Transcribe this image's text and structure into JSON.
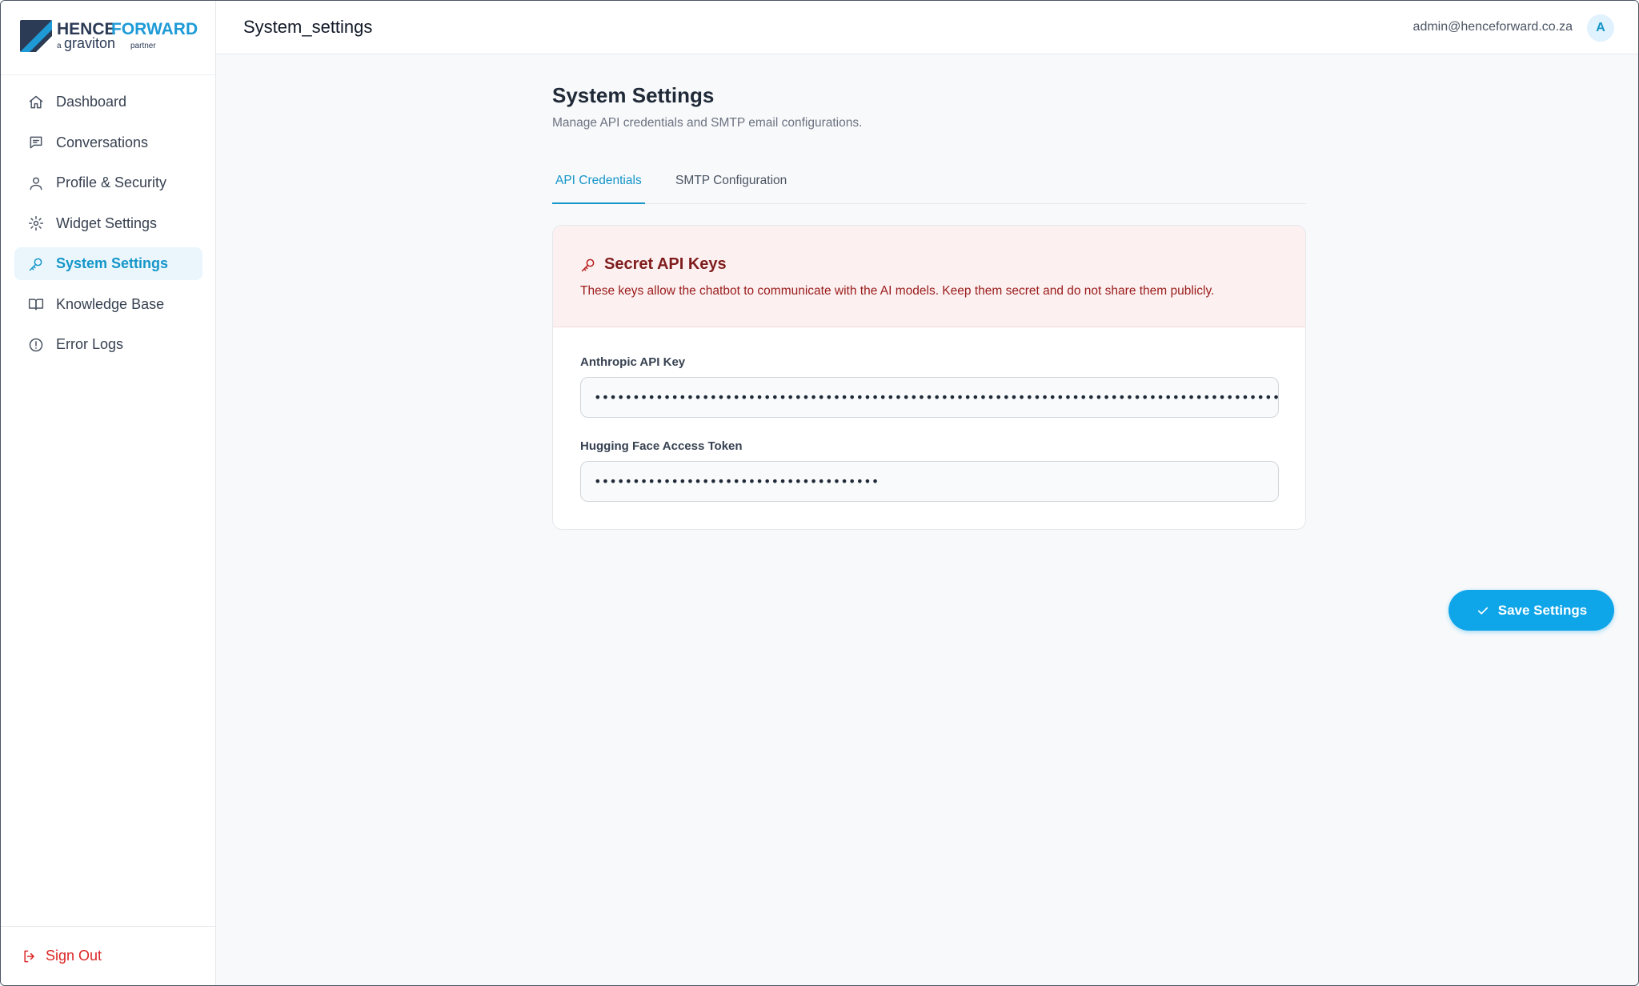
{
  "brand": {
    "name_part1": "HENCE",
    "name_part2": "FORWARD",
    "tagline_prefix": "a",
    "tagline_brand": "graviton",
    "tagline_suffix": "partner"
  },
  "sidebar": {
    "items": [
      {
        "label": "Dashboard",
        "icon": "home-icon"
      },
      {
        "label": "Conversations",
        "icon": "chat-icon"
      },
      {
        "label": "Profile & Security",
        "icon": "user-icon"
      },
      {
        "label": "Widget Settings",
        "icon": "gear-icon"
      },
      {
        "label": "System Settings",
        "icon": "key-icon",
        "active": true
      },
      {
        "label": "Knowledge Base",
        "icon": "book-icon"
      },
      {
        "label": "Error Logs",
        "icon": "alert-circle-icon"
      }
    ],
    "sign_out": "Sign Out"
  },
  "header": {
    "title": "System_settings",
    "user_email": "admin@henceforward.co.za",
    "avatar_initial": "A"
  },
  "main": {
    "title": "System Settings",
    "subtitle": "Manage API credentials and SMTP email configurations.",
    "tabs": [
      {
        "label": "API Credentials",
        "active": true
      },
      {
        "label": "SMTP Configuration",
        "active": false
      }
    ],
    "card": {
      "title": "Secret API Keys",
      "description": "These keys allow the chatbot to communicate with the AI models. Keep them secret and do not share them publicly.",
      "fields": [
        {
          "label": "Anthropic API Key",
          "value": "••••••••••••••••••••••••••••••••••••••••••••••••••••••••••••••••••••••••••••••••••••••••••••••••••••••••••••••••••••••••••"
        },
        {
          "label": "Hugging Face Access Token",
          "value": "•••••••••••••••••••••••••••••••••••••"
        }
      ]
    },
    "save_label": "Save Settings"
  },
  "colors": {
    "accent": "#0ea5e9",
    "active_nav": "#1596c9",
    "danger": "#dc2626",
    "warning_bg": "#fdf0f0"
  }
}
